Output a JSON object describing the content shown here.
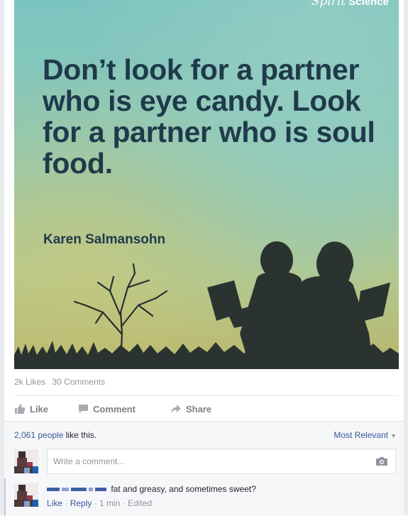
{
  "post": {
    "image": {
      "brand_script": "Spirit",
      "brand_word": "Science",
      "quote": "Don’t look for a partner who is eye candy. Look for a partner who is soul food.",
      "author": "Karen Salmansohn"
    },
    "stats": {
      "likes": "2k Likes",
      "comments": "30 Comments"
    },
    "actions": {
      "like": "Like",
      "comment": "Comment",
      "share": "Share"
    },
    "likes_summary": {
      "count": "2,061 people",
      "suffix": " like this."
    },
    "sort_label": "Most Relevant",
    "write_comment_placeholder": "Write a comment...",
    "comment": {
      "text": "fat and greasy, and sometimes sweet?",
      "like": "Like",
      "reply": "Reply",
      "time": "1 min",
      "edited": "Edited"
    }
  },
  "colors": {
    "link": "#365899",
    "muted": "#90949c",
    "quote_text": "#1f3a4a"
  }
}
